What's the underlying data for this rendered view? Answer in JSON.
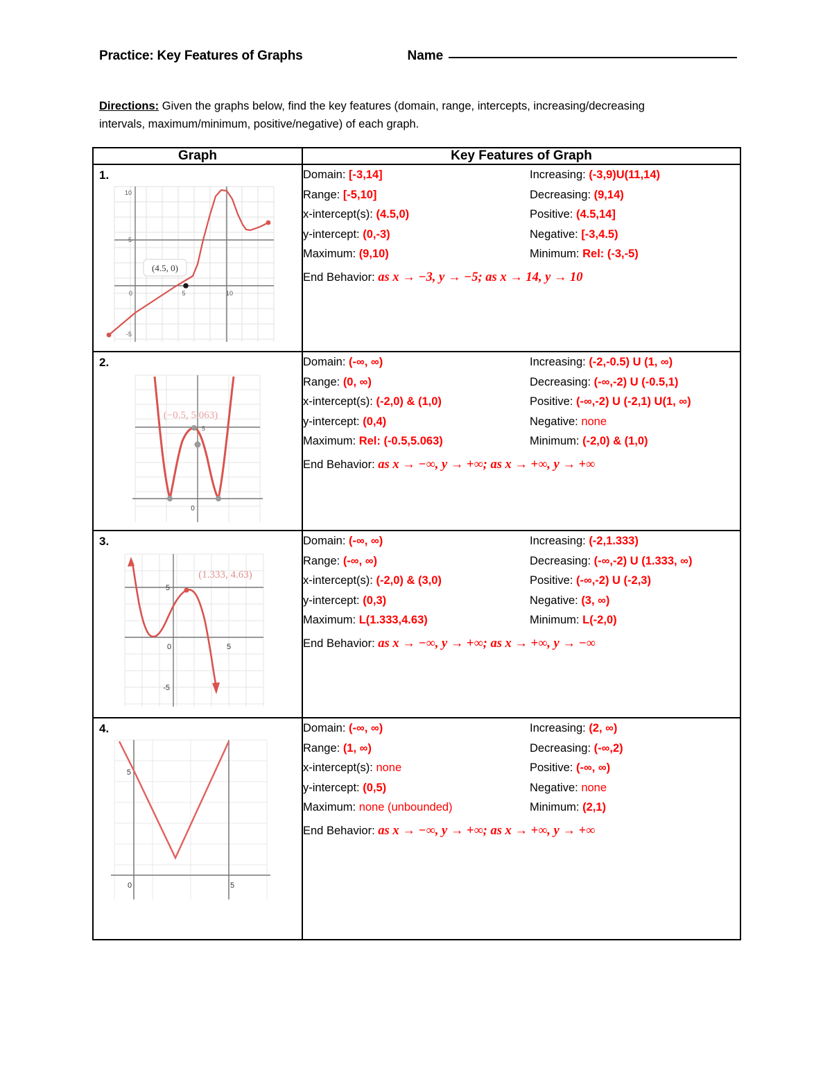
{
  "header": {
    "title": "Practice: Key Features of Graphs",
    "name_label": "Name"
  },
  "directions": {
    "lead": "Directions:",
    "text": " Given the graphs below, find the key features (domain, range, intercepts, increasing/decreasing intervals, maximum/minimum, positive/negative) of each graph."
  },
  "table": {
    "headers": {
      "graph": "Graph",
      "features": "Key Features of Graph"
    },
    "labels": {
      "domain": "Domain:",
      "range": "Range:",
      "x_intercept": "x-intercept(s):",
      "y_intercept": "y-intercept:",
      "maximum": "Maximum:",
      "minimum": "Minimum:",
      "increasing": "Increasing:",
      "decreasing": "Decreasing:",
      "positive": "Positive:",
      "negative": "Negative:",
      "end_behavior": "End Behavior:"
    },
    "rows": [
      {
        "number": "1.",
        "domain": "[-3,14]",
        "range": "[-5,10]",
        "x_intercept": "(4.5,0)",
        "y_intercept": "(0,-3)",
        "maximum": "(9,10)",
        "increasing": "(-3,9)U(11,14)",
        "decreasing": "(9,14)",
        "positive": "(4.5,14]",
        "negative": "[-3,4.5)",
        "minimum": "Rel: (-3,-5)",
        "end_behavior": "as x → −3, y → −5;  as x → 14, y → 10"
      },
      {
        "number": "2.",
        "domain": "(-∞, ∞)",
        "range": "(0, ∞)",
        "x_intercept": "(-2,0) & (1,0)",
        "y_intercept": "(0,4)",
        "maximum": "Rel: (-0.5,5.063)",
        "increasing": "(-2,-0.5) U (1, ∞)",
        "decreasing": "(-∞,-2) U (-0.5,1)",
        "positive": "(-∞,-2) U (-2,1) U(1, ∞)",
        "negative": "none",
        "minimum": "(-2,0) & (1,0)",
        "end_behavior": "as x → −∞, y → +∞;  as x → +∞, y → +∞"
      },
      {
        "number": "3.",
        "domain": "(-∞, ∞)",
        "range": " (-∞, ∞)",
        "x_intercept": "(-2,0) & (3,0)",
        "y_intercept": "(0,3)",
        "maximum": "L(1.333,4.63)",
        "increasing": "(-2,1.333)",
        "decreasing": "(-∞,-2) U (1.333, ∞)",
        "positive": "(-∞,-2) U (-2,3)",
        "negative": "(3, ∞)",
        "minimum": "L(-2,0)",
        "end_behavior": "as x → −∞, y → +∞;  as x → +∞, y → −∞"
      },
      {
        "number": "4.",
        "domain": "(-∞, ∞)",
        "range": "(1, ∞)",
        "x_intercept": "none",
        "y_intercept": "(0,5)",
        "maximum": "none (unbounded)",
        "increasing": "(2, ∞)",
        "decreasing": "(-∞,2)",
        "positive": "(-∞, ∞)",
        "negative": "none",
        "minimum": "(2,1)",
        "end_behavior": "as x → −∞, y → +∞;  as x → +∞, y → +∞"
      }
    ]
  },
  "graphs": [
    {
      "id": "graph-1",
      "point_label": "(4.5, 0)",
      "axis_ticks": [
        "10",
        "5",
        "0",
        "5",
        "10",
        "-5"
      ]
    },
    {
      "id": "graph-2",
      "point_label": "(−0.5, 5.063)",
      "axis_ticks": [
        "5",
        "0"
      ]
    },
    {
      "id": "graph-3",
      "point_label": "(1.333, 4.63)",
      "axis_ticks": [
        "5",
        "0",
        "5",
        "-5"
      ]
    },
    {
      "id": "graph-4",
      "point_label": "",
      "axis_ticks": [
        "5",
        "0",
        "5"
      ]
    }
  ],
  "colors": {
    "answer_red": "#ff0000",
    "curve_red": "#d9534f",
    "grid": "#dddddd",
    "axis": "#666666"
  }
}
